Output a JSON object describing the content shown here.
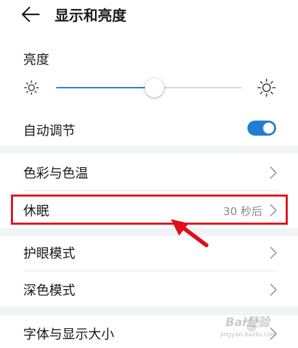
{
  "header": {
    "title": "显示和亮度"
  },
  "brightness": {
    "label": "亮度",
    "level_fraction": 0.53
  },
  "auto_adjust": {
    "label": "自动调节",
    "enabled": true
  },
  "settings": {
    "color_temp": "色彩与色温",
    "sleep": {
      "label": "休眠",
      "value": "30 秒后"
    },
    "eye_comfort": "护眼模式",
    "dark_mode": "深色模式",
    "font_display_size": "字体与显示大小"
  },
  "watermark": {
    "brand": "Bai经验",
    "url": "jingyan.baidu.com"
  },
  "colors": {
    "accent": "#1f7fd6",
    "annotation": "#e0101a"
  }
}
